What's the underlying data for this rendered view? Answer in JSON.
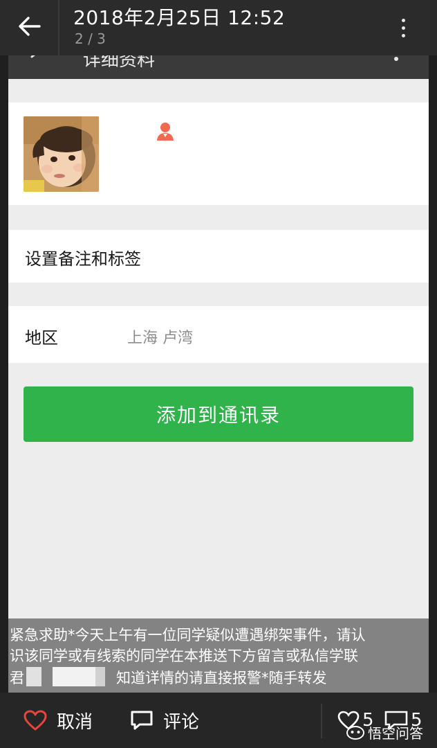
{
  "viewer": {
    "date_time": "2018年2月25日 12:52",
    "page_indicator": "2 / 3"
  },
  "screenshot": {
    "header_title": "详细资料",
    "remark_label": "设置备注和标签",
    "region_label": "地区",
    "region_value": "上海  卢湾",
    "add_button_label": "添加到通讯录"
  },
  "caption": {
    "line1": "紧急求助*今天上午有一位同学疑似遭遇绑架事件，请认",
    "line2": "识该同学或有线索的同学在本推送下方留言或私信学联",
    "line3_prefix": "君",
    "line3_rest": "知道详情的请直接报警*随手转发"
  },
  "bottom_bar": {
    "like_label": "取消",
    "comment_label": "评论",
    "likes_count": "5",
    "comments_count": "5",
    "watermark": "悟空问答"
  },
  "icons": {
    "back": "back-arrow-icon",
    "more": "more-vertical-icon",
    "heart": "heart-outline-icon",
    "comment": "comment-bubble-icon",
    "gender": "person-female-icon",
    "watermark": "wukong-logo-icon"
  },
  "colors": {
    "accent_green": "#2fb34a",
    "heart_red": "#e8453c",
    "gender_icon": "#f06a50"
  }
}
